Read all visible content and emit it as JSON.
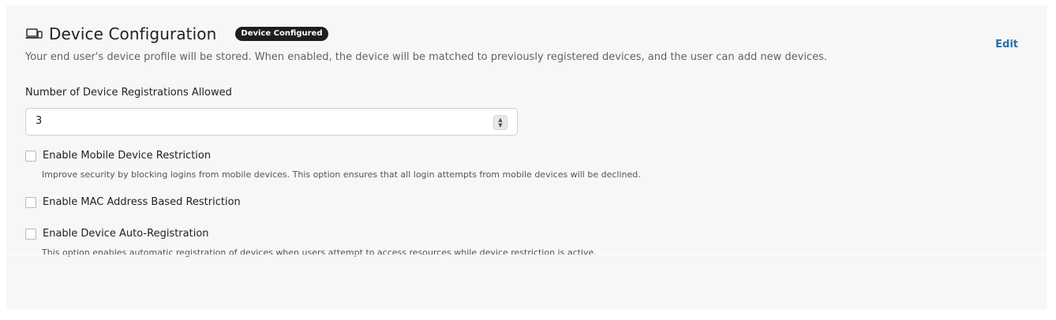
{
  "section": {
    "title": "Device Configuration",
    "badge": "Device Configured",
    "edit_label": "Edit",
    "description": "Your end user's device profile will be stored. When enabled, the device will be matched to previously registered devices, and the user can add new devices."
  },
  "registrations": {
    "label": "Number of Device Registrations Allowed",
    "value": "3"
  },
  "options": [
    {
      "label": "Enable Mobile Device Restriction",
      "help": "Improve security by blocking logins from mobile devices. This option ensures that all login attempts from mobile devices will be declined.",
      "checked": false
    },
    {
      "label": "Enable MAC Address Based Restriction",
      "checked": false
    },
    {
      "label": "Enable Device Auto-Registration",
      "help": "This option enables automatic registration of devices when users attempt to access resources while device restriction is active.",
      "checked": false
    }
  ],
  "colors": {
    "badge_bg": "#1e1e1e",
    "link": "#2f6ea5",
    "panel_bg": "#f7f7f7"
  }
}
